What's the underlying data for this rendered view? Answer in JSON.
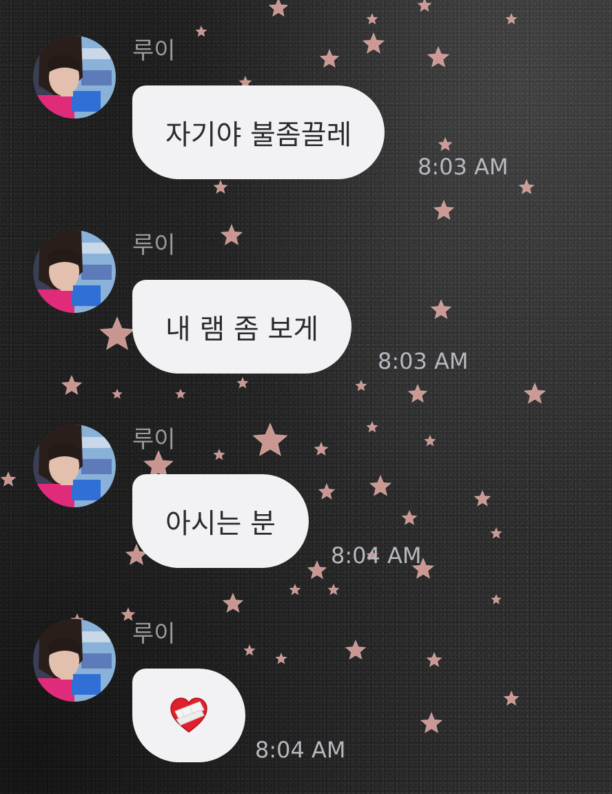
{
  "chat": {
    "messages": [
      {
        "sender": "루이",
        "text": "자기야 불좀끌레",
        "time": "8:03 AM"
      },
      {
        "sender": "루이",
        "text": "내 램 좀 보게",
        "time": "8:03 AM"
      },
      {
        "sender": "루이",
        "text": "아시는 분",
        "time": "8:04 AM"
      },
      {
        "sender": "루이",
        "emoji": "broken-heart-bandaged",
        "time": "8:04 AM"
      }
    ]
  },
  "colors": {
    "bubble": "#f2f2f4",
    "bubble_text": "#2b2b2f",
    "sender_name": "#9a9a9f",
    "timestamp": "#b8b8c0",
    "star": "#e7aaa5",
    "background": "#2f2f2f"
  },
  "icons": {
    "avatar": "profile-photo",
    "heart": "mending-heart-emoji",
    "background_stars": "star-icon"
  }
}
